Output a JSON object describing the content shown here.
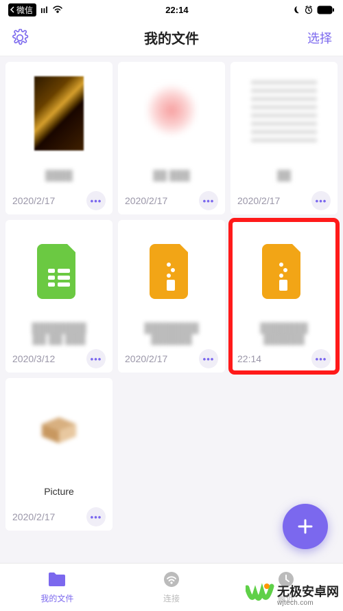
{
  "status": {
    "back_app": "微信",
    "signal": "ııl",
    "time": "22:14"
  },
  "nav": {
    "title": "我的文件",
    "select": "选择"
  },
  "files": [
    {
      "name": "████",
      "date": "2020/2/17",
      "thumb": "mona",
      "highlight": false
    },
    {
      "name": "██ ███",
      "date": "2020/2/17",
      "thumb": "pink",
      "highlight": false
    },
    {
      "name": "██",
      "date": "2020/2/17",
      "thumb": "doc",
      "highlight": false
    },
    {
      "name": "████████\n██ ██ ███",
      "date": "2020/3/12",
      "thumb": "sheet",
      "highlight": false
    },
    {
      "name": "████████\n██████",
      "date": "2020/2/17",
      "thumb": "zip",
      "highlight": false
    },
    {
      "name": "███████\n██████",
      "date": "22:14",
      "thumb": "zip",
      "highlight": true
    },
    {
      "name": "Picture",
      "date": "2020/2/17",
      "thumb": "box",
      "highlight": false
    }
  ],
  "tabs": [
    {
      "label": "我的文件",
      "icon": "folder",
      "active": true
    },
    {
      "label": "连接",
      "icon": "wifi",
      "active": false
    },
    {
      "label": "最近",
      "icon": "clock",
      "active": false
    }
  ],
  "watermark": {
    "main": "无极安卓网",
    "sub": "wjtech.com"
  },
  "icons": {
    "more": "•••",
    "plus": "+"
  }
}
